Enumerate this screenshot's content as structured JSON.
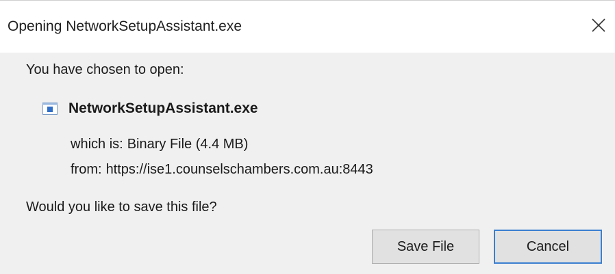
{
  "window": {
    "title": "Opening NetworkSetupAssistant.exe",
    "close_icon": "close-icon"
  },
  "dialog": {
    "intro": "You have chosen to open:",
    "file": {
      "icon": "executable-file-icon",
      "name": "NetworkSetupAssistant.exe"
    },
    "details": {
      "type_label": "which is:",
      "type_value": "Binary File (4.4 MB)",
      "from_label": "from:",
      "from_value": "https://ise1.counselschambers.com.au:8443"
    },
    "question": "Would you like to save this file?"
  },
  "buttons": {
    "save": "Save File",
    "cancel": "Cancel"
  },
  "colors": {
    "background": "#f0f0f0",
    "titlebar": "#ffffff",
    "button_face": "#e1e1e1",
    "default_button_border": "#3a7fd0",
    "file_icon_accent": "#2f6fc9"
  }
}
